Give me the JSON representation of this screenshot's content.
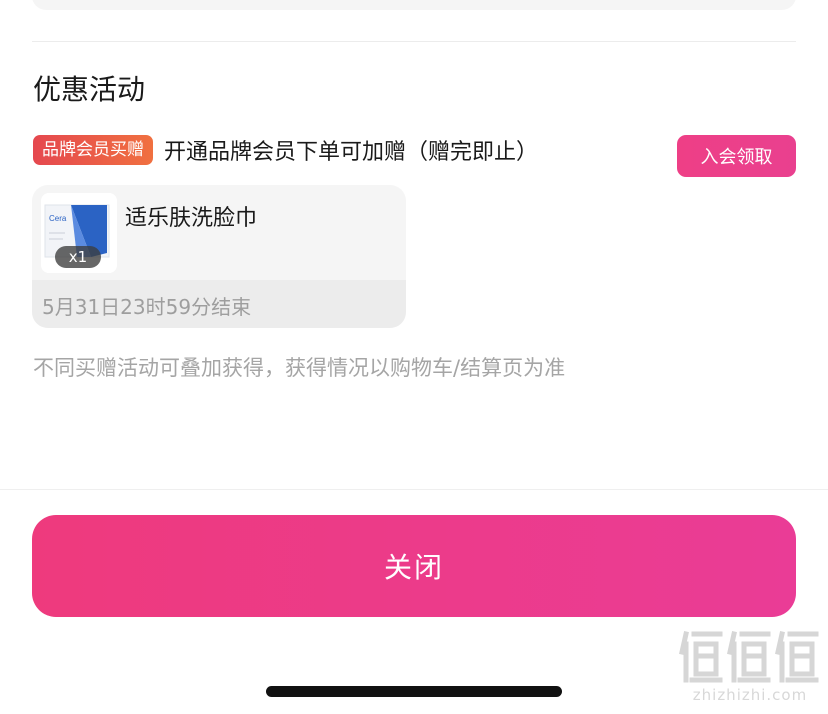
{
  "section": {
    "title": "优惠活动"
  },
  "promo": {
    "tag": "品牌会员买赠",
    "description": "开通品牌会员下单可加赠（赠完即止）",
    "join_button": "入会领取",
    "tag_color": "#e5484f",
    "button_color": "#ee3f86"
  },
  "gift": {
    "name": "适乐肤洗脸巾",
    "quantity": "x1",
    "deadline": "5月31日23时59分结束",
    "thumb_brand": "Cera"
  },
  "note": "不同买赠活动可叠加获得，获得情况以购物车/结算页为准",
  "footer": {
    "close_button": "关闭",
    "button_color": "#ee3a7d"
  },
  "watermark": {
    "text": "zhizhizhi.com",
    "logo_alt": "值值值"
  }
}
